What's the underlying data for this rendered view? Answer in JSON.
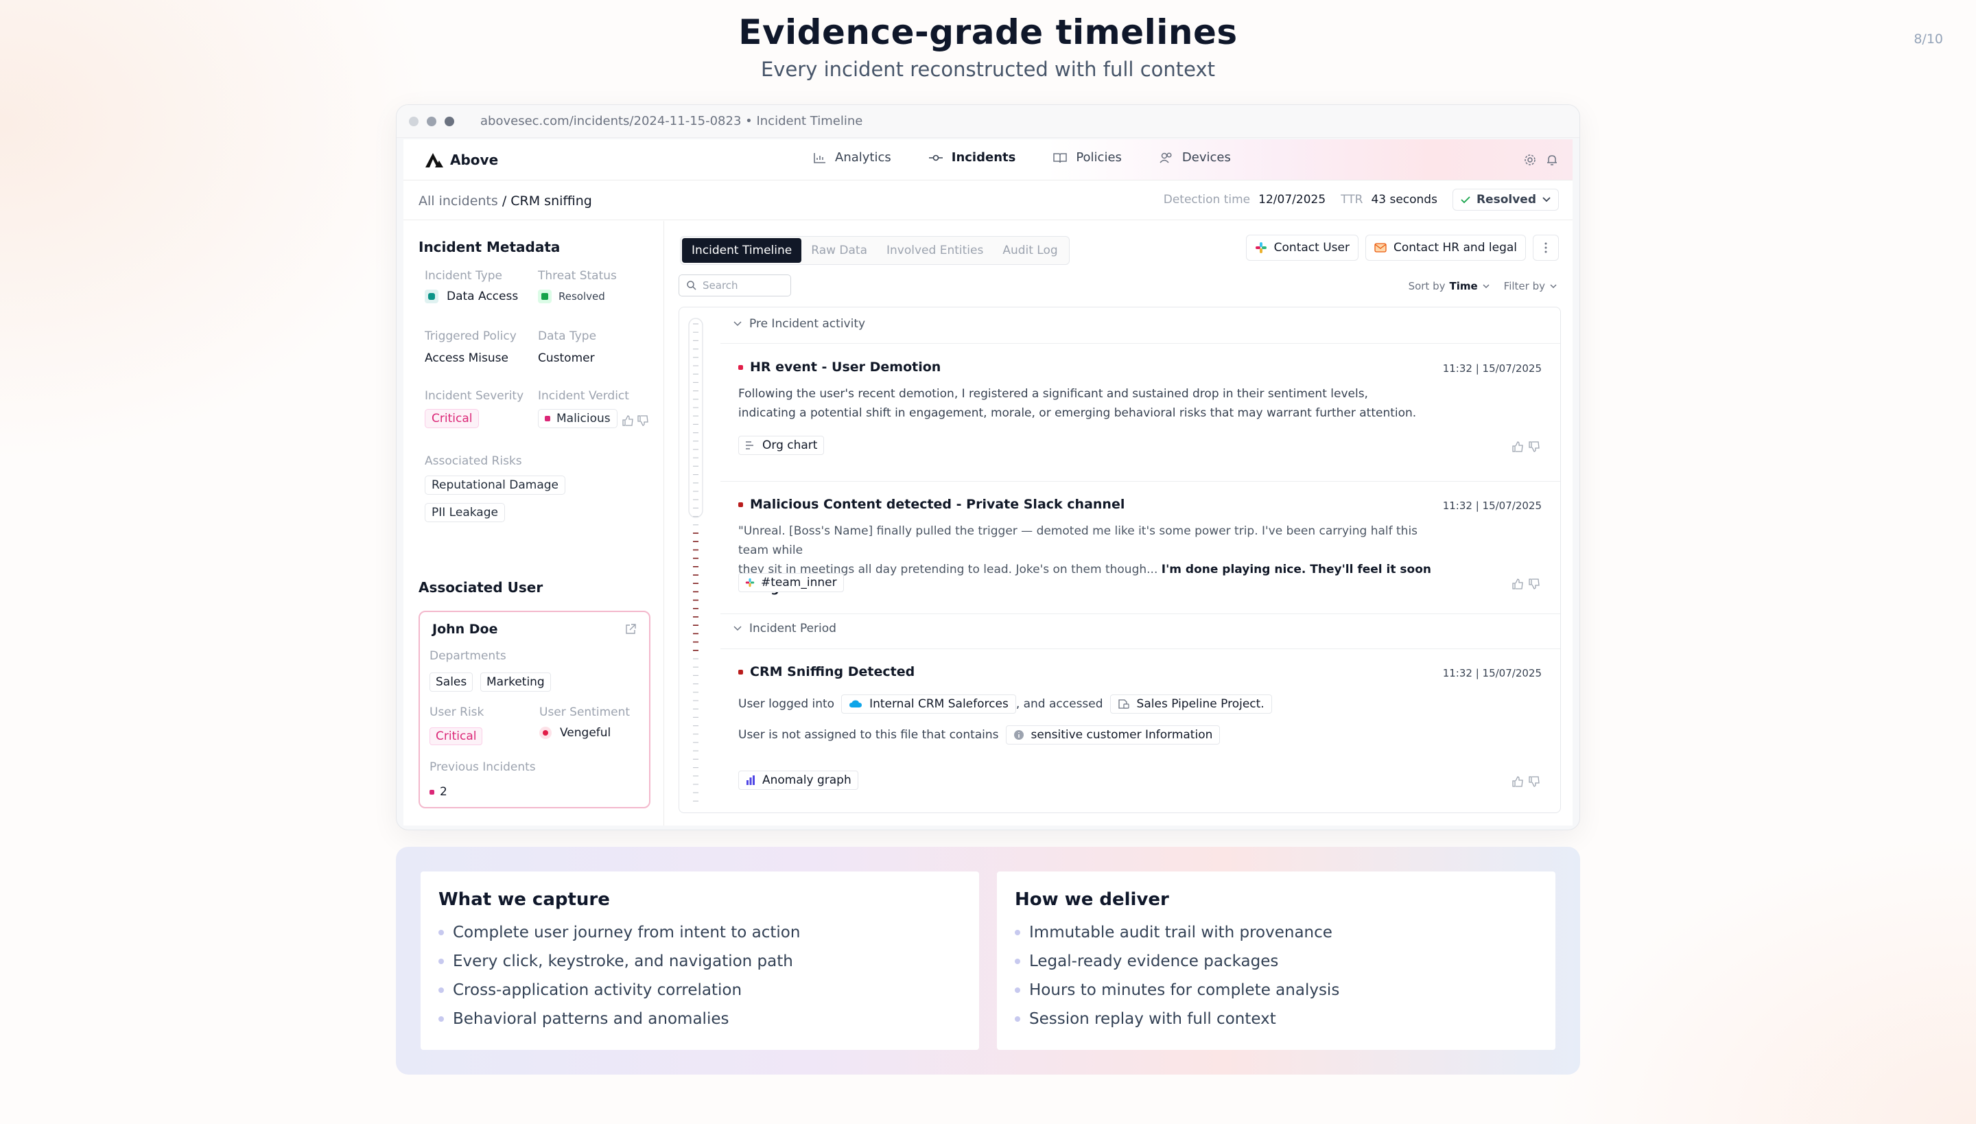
{
  "slide": {
    "title": "Evidence-grade timelines",
    "subtitle": "Every incident reconstructed with full context",
    "page": "8/10"
  },
  "window": {
    "url": "abovesec.com/incidents/2024-11-15-0823 • Incident Timeline"
  },
  "app": {
    "brand": "Above",
    "nav": [
      {
        "label": "Analytics",
        "icon": "chart-icon"
      },
      {
        "label": "Incidents",
        "icon": "incidents-icon",
        "active": true
      },
      {
        "label": "Policies",
        "icon": "book-icon"
      },
      {
        "label": "Devices",
        "icon": "devices-icon"
      }
    ]
  },
  "subbar": {
    "crumb_root": "All incidents",
    "crumb_sep": " / ",
    "crumb_current": "CRM sniffing",
    "detection_label": "Detection time",
    "detection_value": "12/07/2025",
    "ttr_label": "TTR",
    "ttr_value": "43 seconds",
    "status": "Resolved"
  },
  "metadata": {
    "heading": "Incident Metadata",
    "incident_type_label": "Incident Type",
    "incident_type": "Data Access",
    "threat_status_label": "Threat Status",
    "threat_status": "Resolved",
    "triggered_policy_label": "Triggered Policy",
    "triggered_policy": "Access Misuse",
    "data_type_label": "Data Type",
    "data_type": "Customer",
    "severity_label": "Incident Severity",
    "severity": "Critical",
    "verdict_label": "Incident Verdict",
    "verdict": "Malicious",
    "risks_label": "Associated Risks",
    "risks": [
      "Reputational Damage",
      "PII Leakage"
    ]
  },
  "user": {
    "heading": "Associated User",
    "name": "John Doe",
    "departments_label": "Departments",
    "departments": [
      "Sales",
      "Marketing"
    ],
    "risk_label": "User Risk",
    "risk": "Critical",
    "sentiment_label": "User Sentiment",
    "sentiment": "Vengeful",
    "previous_label": "Previous Incidents",
    "previous": "2"
  },
  "main": {
    "tabs": [
      "Incident Timeline",
      "Raw Data",
      "Involved Entities",
      "Audit Log"
    ],
    "contact_user": "Contact User",
    "contact_hr": "Contact HR and legal",
    "search_placeholder": "Search",
    "sort_label": "Sort by",
    "sort_value": "Time",
    "filter_label": "Filter by"
  },
  "timeline": {
    "group1": "Pre Incident activity",
    "group2": "Incident Period",
    "events": [
      {
        "title": "HR event - User Demotion",
        "time": "11:32 | 15/07/2025",
        "body1": "Following the user's recent demotion, I registered a significant and sustained drop in their sentiment levels,",
        "body2": "indicating a potential shift in engagement, morale, or emerging behavioral risks that may warrant further attention.",
        "chip": "Org chart"
      },
      {
        "title": "Malicious Content detected - Private Slack channel",
        "time": "11:32 | 15/07/2025",
        "body1": "\"Unreal. [Boss's Name] finally pulled the trigger — demoted me like it's some power trip. I've been carrying half this team while",
        "body2_plain": "they sit in meetings all day pretending to lead. Joke's on them though... ",
        "body2_bold": "I'm done playing nice. They'll feel it soon enough.",
        "body2_end": "\"",
        "chip": "#team_inner"
      },
      {
        "title": "CRM Sniffing Detected",
        "time": "11:32 | 15/07/2025",
        "line1_a": "User logged into",
        "line1_chip1": "Internal CRM Saleforces",
        "line1_b": ", and accessed",
        "line1_chip2": "Sales Pipeline Project.",
        "line2_a": "User is not assigned to this file that contains",
        "line2_chip": "sensitive customer Information",
        "chip": "Anomaly graph"
      }
    ]
  },
  "capture": {
    "heading": "What we capture",
    "items": [
      "Complete user journey from intent to action",
      "Every click, keystroke, and navigation path",
      "Cross-application activity correlation",
      "Behavioral patterns and anomalies"
    ]
  },
  "deliver": {
    "heading": "How we deliver",
    "items": [
      "Immutable audit trail with provenance",
      "Legal-ready evidence packages",
      "Hours to minutes for complete analysis",
      "Session replay with full context"
    ]
  },
  "colors": {
    "critical": "#db2777",
    "accent_dark": "#111827",
    "malicious_red": "#b91c1c"
  }
}
